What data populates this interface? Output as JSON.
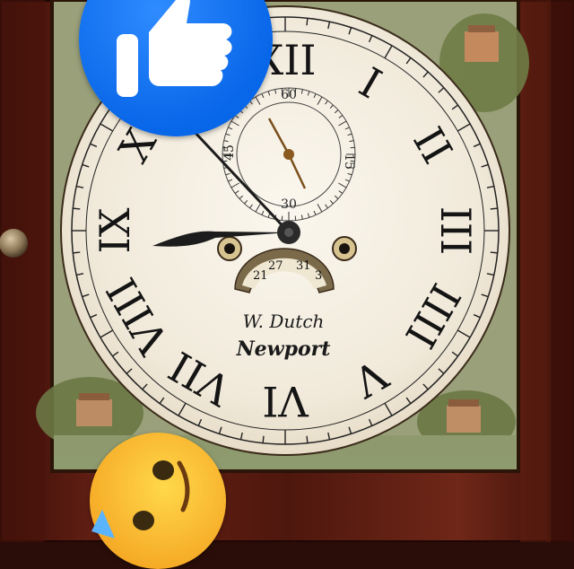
{
  "clock": {
    "maker_line": "W. Dutch",
    "town_line": "Newport",
    "roman_numerals": [
      "XII",
      "I",
      "II",
      "III",
      "IIII",
      "V",
      "VI",
      "VII",
      "VIII",
      "IX",
      "X",
      "XI"
    ],
    "seconds_dial_labels": [
      "60",
      "15",
      "30",
      "45"
    ],
    "date_window_labels": [
      "21",
      "27",
      "31",
      "3"
    ]
  },
  "reactions": {
    "like_icon": "thumbs-up-icon",
    "face_icon": "tearful-face-icon"
  },
  "colors": {
    "case_mahogany": "#5a1a10",
    "dial_ivory": "#f2ecde",
    "numeral_black": "#141414",
    "like_blue": "#0866e8",
    "face_yellow": "#f5b52a"
  }
}
